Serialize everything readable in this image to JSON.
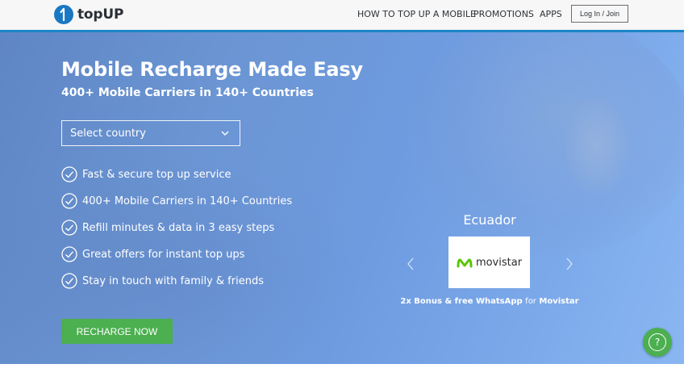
{
  "header": {
    "logo_text": "topUP",
    "nav": [
      {
        "label": "HOW TO TOP UP A MOBILE"
      },
      {
        "label": "PROMOTIONS"
      },
      {
        "label": "APPS"
      }
    ],
    "login_label": "Log In / Join"
  },
  "hero": {
    "title": "Mobile Recharge Made Easy",
    "subtitle": "400+ Mobile Carriers in 140+ Countries",
    "country_select": {
      "value": "Select country"
    },
    "features": [
      "Fast & secure top up service",
      "400+ Mobile Carriers in 140+ Countries",
      "Refill minutes & data in 3 easy steps",
      "Great offers for instant top ups",
      "Stay in touch with family & friends"
    ],
    "cta_label": "RECHARGE NOW"
  },
  "promo": {
    "country": "Ecuador",
    "brand_name": "movistar",
    "caption_main": "2x Bonus & free WhatsApp",
    "caption_for": "for",
    "caption_carrier": "Movistar"
  },
  "help": {
    "glyph": "?"
  },
  "colors": {
    "accent_blue": "#1a86c8",
    "cta_green": "#4caf50",
    "movistar_green": "#5bc500"
  },
  "icons": {
    "logo": "topup-logo-icon",
    "select": "chevron-down-icon",
    "feature": "check-circle-icon",
    "prev": "chevron-left-icon",
    "next": "chevron-right-icon",
    "help": "help-icon"
  }
}
